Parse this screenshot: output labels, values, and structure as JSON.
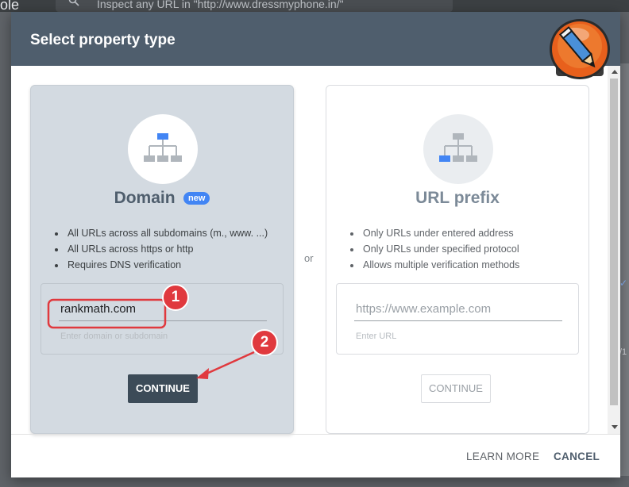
{
  "background": {
    "brand_text": "ole",
    "search_placeholder": "Inspect any URL in \"http://www.dressmyphone.in/\"",
    "side_text": "/1"
  },
  "dialog": {
    "title": "Select property type",
    "or_label": "or"
  },
  "domain_card": {
    "title": "Domain",
    "badge": "new",
    "features": [
      "All URLs across all subdomains (m., www. ...)",
      "All URLs across https or http",
      "Requires DNS verification"
    ],
    "input_value": "rankmath.com",
    "helper": "Enter domain or subdomain",
    "button_label": "CONTINUE"
  },
  "url_card": {
    "title": "URL prefix",
    "features": [
      "Only URLs under entered address",
      "Only URLs under specified protocol",
      "Allows multiple verification methods"
    ],
    "input_placeholder": "https://www.example.com",
    "helper": "Enter URL",
    "button_label": "CONTINUE"
  },
  "footer": {
    "learn_more": "LEARN MORE",
    "cancel": "CANCEL"
  },
  "annotations": {
    "step_1": "1",
    "step_2": "2",
    "accent_color": "#e0393e"
  },
  "colors": {
    "header": "#4f5e6d",
    "primary_button": "#3c4b58",
    "badge": "#4285f4"
  }
}
